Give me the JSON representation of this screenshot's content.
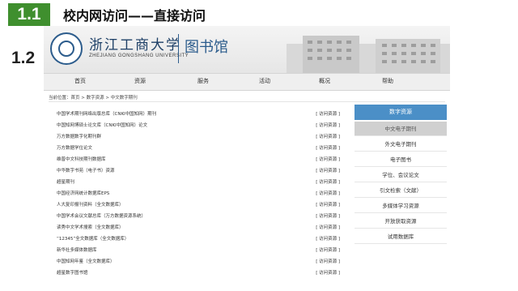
{
  "slide": {
    "section_badge": "1.1",
    "title": "校内网访问——直接访问",
    "section_badge_2": "1.2"
  },
  "banner": {
    "university_name": "浙江工商大学",
    "university_name_en": "ZHEJIANG GONGSHANG UNIVERSITY",
    "library_name": "图书馆"
  },
  "nav": {
    "items": [
      "首页",
      "资源",
      "服务",
      "活动",
      "概况",
      "帮助"
    ]
  },
  "breadcrumb": "当前位置：首页 > 数字资源 > 中文数字期刊",
  "resources": [
    {
      "title": "中国学术期刊网络出版总库（CNKI中国知网）期刊",
      "link": "[ 访问资源 ]"
    },
    {
      "title": "中国知网博硕士论文库（CNKI中国知网）论文",
      "link": "[ 访问资源 ]"
    },
    {
      "title": "万方数据数字化期刊群",
      "link": "[ 访问资源 ]"
    },
    {
      "title": "万方数据学位论文",
      "link": "[ 访问资源 ]"
    },
    {
      "title": "维普中文科技期刊数据库",
      "link": "[ 访问资源 ]"
    },
    {
      "title": "中华数字书苑（电子书）资源",
      "link": "[ 访问资源 ]"
    },
    {
      "title": "超星期刊",
      "link": "[ 访问资源 ]"
    },
    {
      "title": "中国经济网统计数据库EPS",
      "link": "[ 访问资源 ]"
    },
    {
      "title": "人大复印报刊资料（全文数据库）",
      "link": "[ 访问资源 ]"
    },
    {
      "title": "中国学术会议文献总库（万方数据资源系统）",
      "link": "[ 访问资源 ]"
    },
    {
      "title": "读秀中文学术搜索（全文数据库）",
      "link": "[ 访问资源 ]"
    },
    {
      "title": "“12345”全文数据库（全文数据库）",
      "link": "[ 访问资源 ]"
    },
    {
      "title": "新华社多媒体数据库",
      "link": "[ 访问资源 ]"
    },
    {
      "title": "中国知网年鉴（全文数据库）",
      "link": "[ 访问资源 ]"
    },
    {
      "title": "超星数字图书馆",
      "link": "[ 访问资源 ]"
    }
  ],
  "sidebar": {
    "header": "数字资源",
    "items": [
      "中文电子期刊",
      "外文电子期刊",
      "电子图书",
      "学位、会议论文",
      "引文检索（文献）",
      "多媒体学习资源",
      "开放获取资源",
      "试用数据库"
    ]
  }
}
